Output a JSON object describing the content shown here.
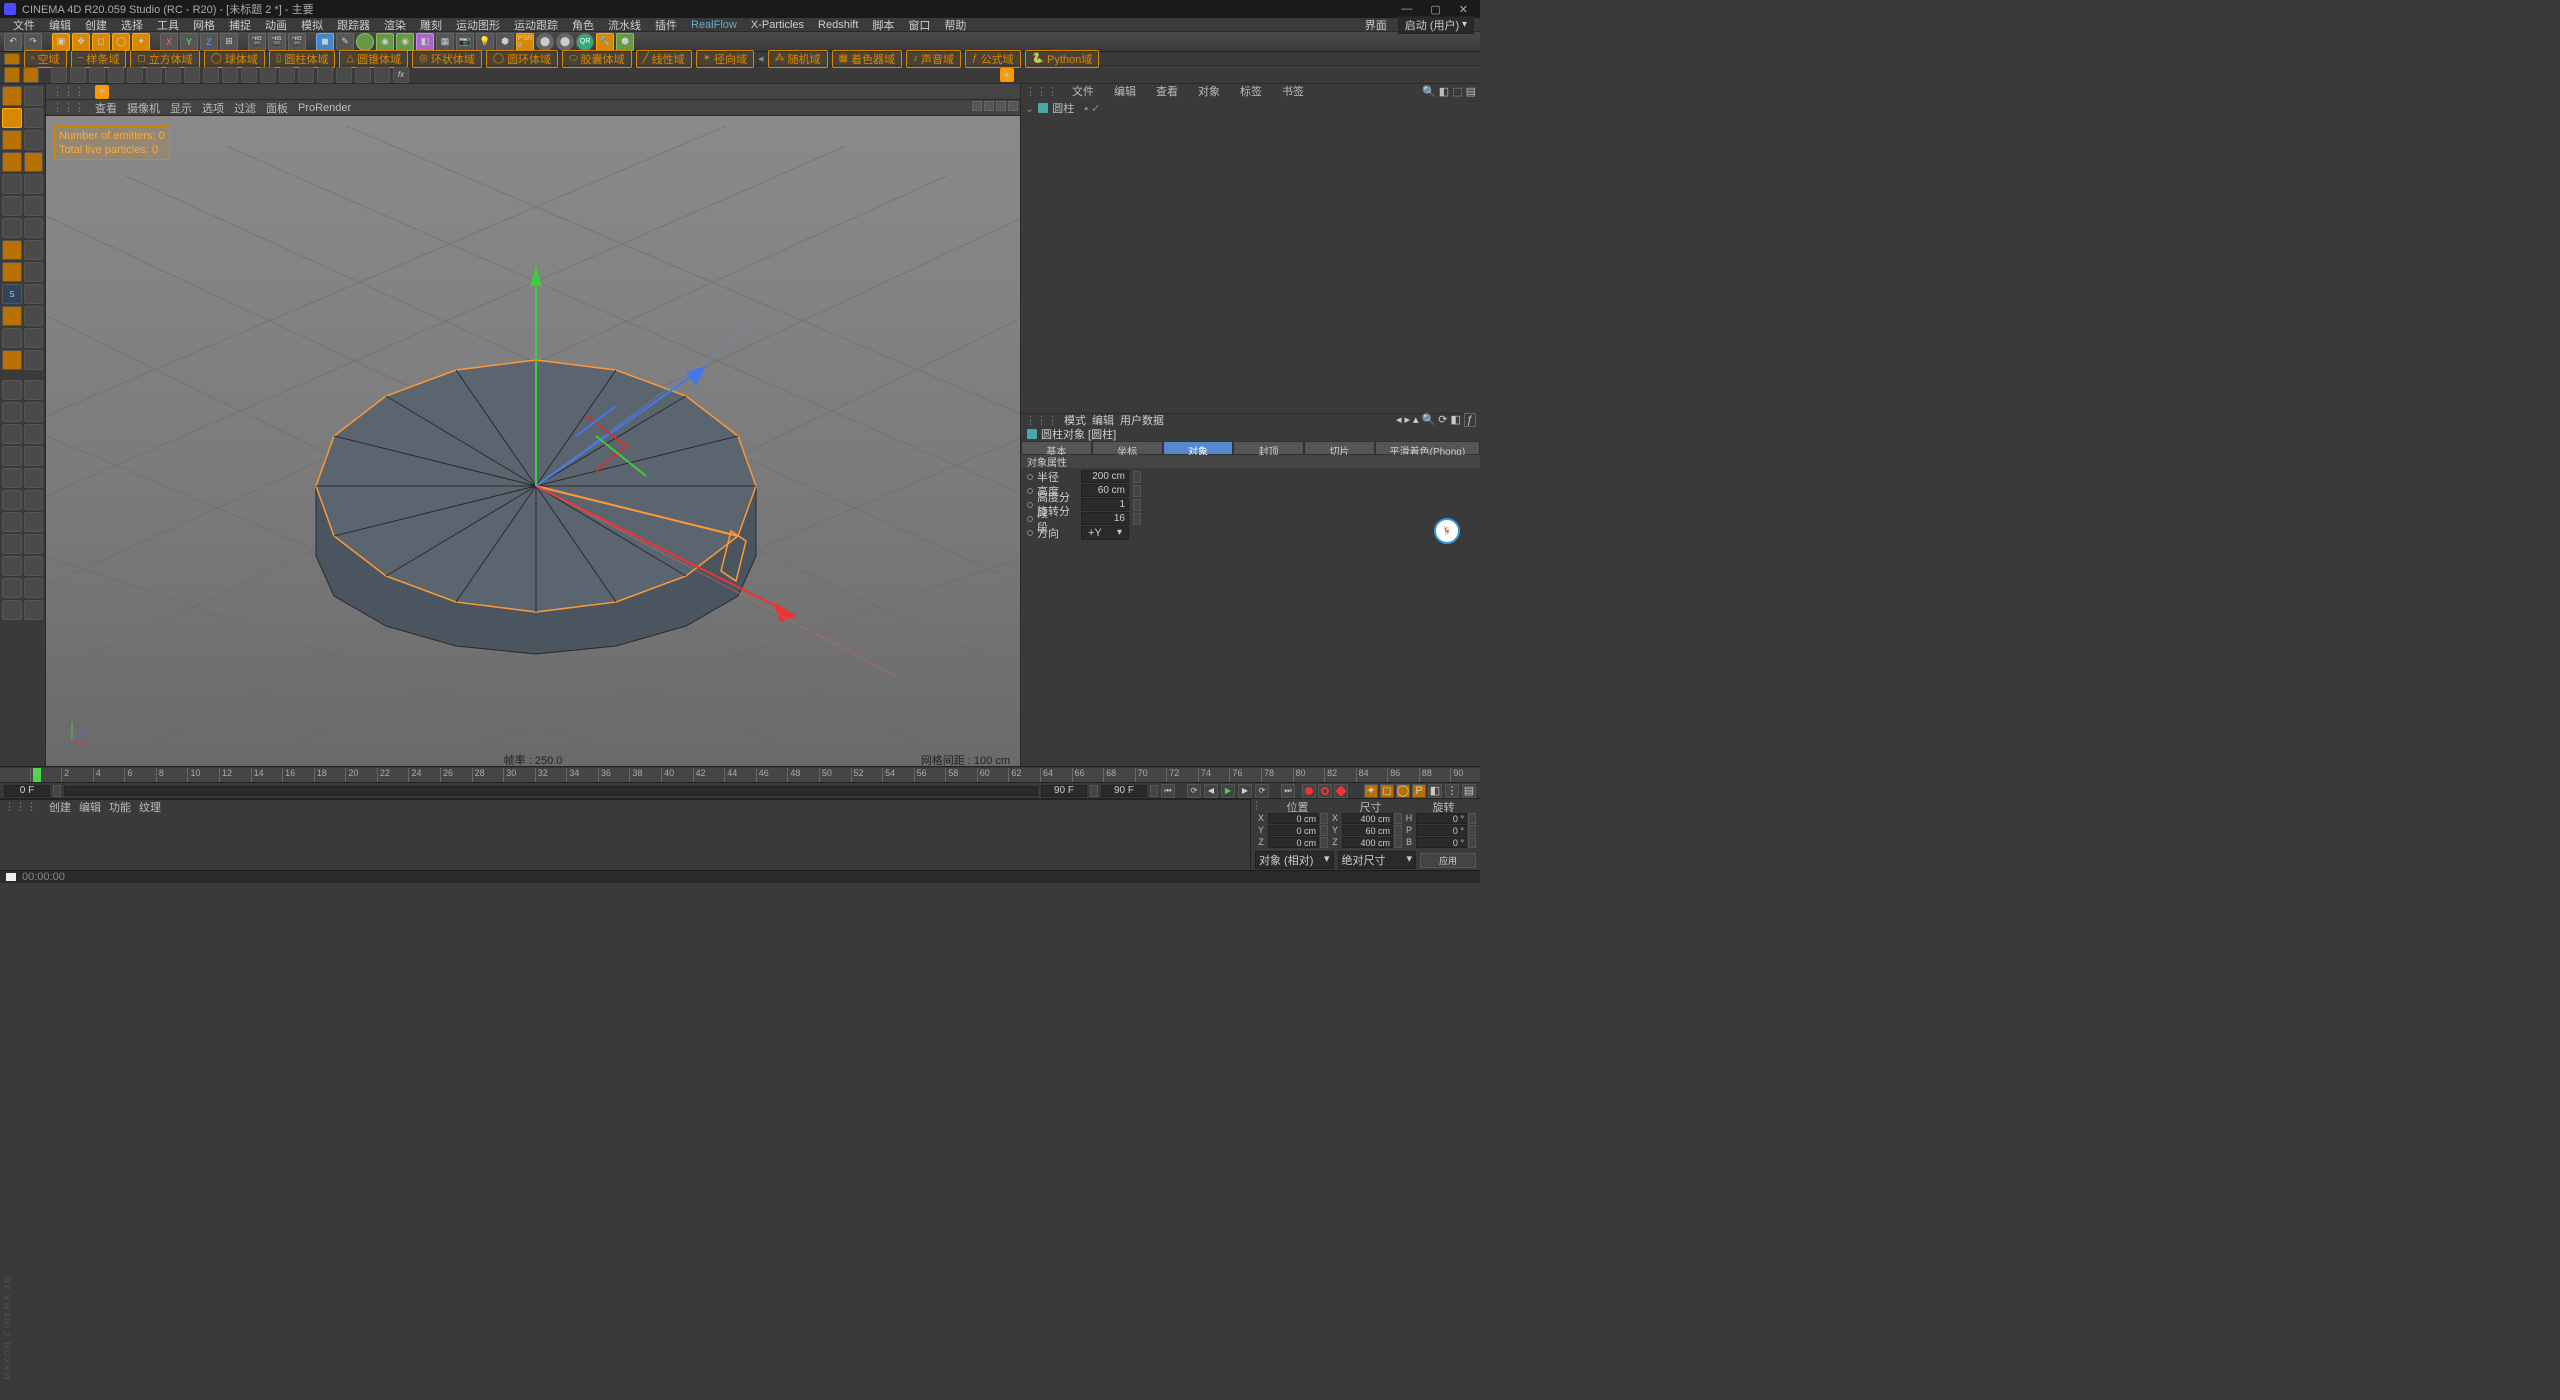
{
  "app": {
    "title": "CINEMA 4D R20.059 Studio (RC - R20) - [未标题 2 *] - 主要"
  },
  "menu": {
    "items": [
      "文件",
      "编辑",
      "创建",
      "选择",
      "工具",
      "网格",
      "捕捉",
      "动画",
      "模拟",
      "跟踪器",
      "渲染",
      "雕刻",
      "运动图形",
      "运动跟踪",
      "角色",
      "流水线",
      "插件",
      "RealFlow",
      "X-Particles",
      "Redshift",
      "脚本",
      "窗口",
      "帮助"
    ],
    "layout_label": "界面",
    "layout_value": "启动 (用户)"
  },
  "palette": {
    "domains": [
      "空域",
      "样条域",
      "立方体域",
      "球体域",
      "圆柱体域",
      "圆锥体域",
      "环状体域",
      "圆环体域",
      "胶囊体域",
      "线性域",
      "径向域",
      "随机域",
      "着色器域",
      "声音域",
      "公式域",
      "Python域"
    ]
  },
  "viewport": {
    "shelf": [
      "查看",
      "摄像机",
      "显示",
      "选项",
      "过滤",
      "面板",
      "ProRender"
    ],
    "particles_emitters": "Number of emitters: 0",
    "particles_live": "Total live particles: 0",
    "fps_label": "帧率 :",
    "fps_value": "250.0",
    "grid_label": "网格间距 :",
    "grid_value": "100 cm"
  },
  "objects": {
    "tabs": [
      "文件",
      "编辑",
      "查看",
      "对象",
      "标签",
      "书签"
    ],
    "root": "圆柱"
  },
  "attrib": {
    "tabs": [
      "模式",
      "编辑",
      "用户数据"
    ],
    "object_title": "圆柱对象 [圆柱]",
    "tab_row": [
      "基本",
      "坐标",
      "对象",
      "封顶",
      "切片",
      "平滑着色(Phong)"
    ],
    "active_tab": 2,
    "section": "对象属性",
    "rows": [
      {
        "label": "半径",
        "value": "200 cm"
      },
      {
        "label": "高度",
        "value": "60 cm"
      },
      {
        "label": "高度分段",
        "value": "1"
      },
      {
        "label": "旋转分段",
        "value": "16"
      },
      {
        "label": "方向",
        "value": "+Y"
      }
    ]
  },
  "timeline": {
    "ticks": [
      "0",
      "2",
      "4",
      "6",
      "8",
      "10",
      "12",
      "14",
      "16",
      "18",
      "20",
      "22",
      "24",
      "26",
      "28",
      "30",
      "32",
      "34",
      "36",
      "38",
      "40",
      "42",
      "44",
      "46",
      "48",
      "50",
      "52",
      "54",
      "56",
      "58",
      "60",
      "62",
      "64",
      "66",
      "68",
      "70",
      "72",
      "74",
      "76",
      "78",
      "80",
      "82",
      "84",
      "86",
      "88",
      "90"
    ],
    "start_frame": "0 F",
    "mid_frame": "90 F",
    "end_frame": "90 F"
  },
  "coords": {
    "headers": [
      "位置",
      "尺寸",
      "旋转"
    ],
    "rows": [
      {
        "a": "X",
        "av": "0 cm",
        "b": "X",
        "bv": "400 cm",
        "c": "H",
        "cv": "0 °"
      },
      {
        "a": "Y",
        "av": "0 cm",
        "b": "Y",
        "bv": "60 cm",
        "c": "P",
        "cv": "0 °"
      },
      {
        "a": "Z",
        "av": "0 cm",
        "b": "Z",
        "bv": "400 cm",
        "c": "B",
        "cv": "0 °"
      }
    ],
    "mode1": "对象 (相对)",
    "mode2": "绝对尺寸",
    "apply": "应用"
  },
  "bottom_tabs": [
    "创建",
    "编辑",
    "功能",
    "纹理"
  ],
  "status": {
    "time": "00:00:00"
  }
}
